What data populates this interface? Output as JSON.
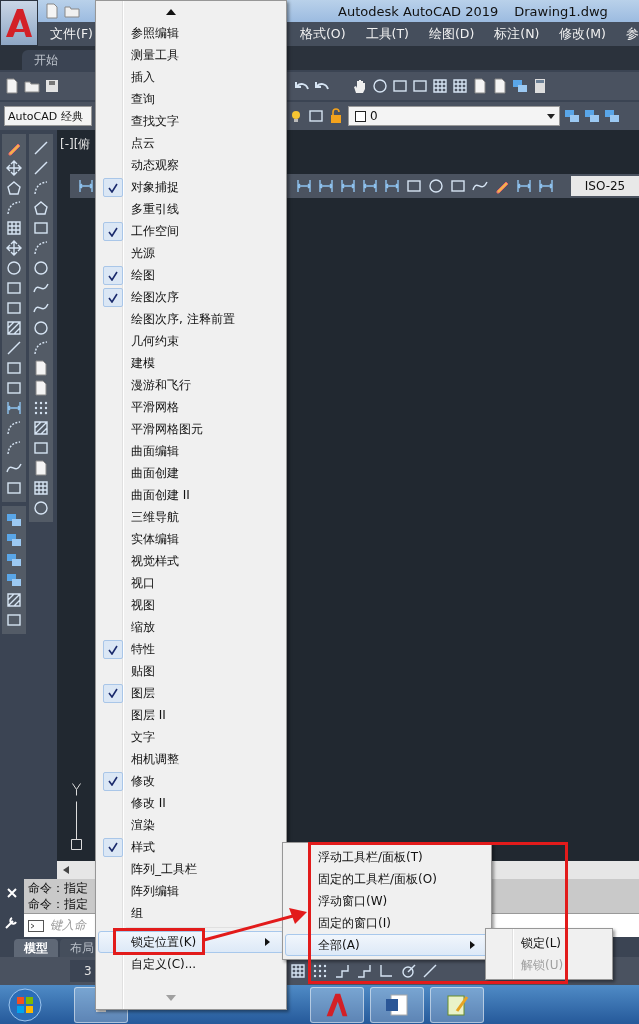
{
  "title_bar": {
    "title": "Autodesk AutoCAD 2019",
    "document": "Drawing1.dwg"
  },
  "menu_bar": {
    "first": "文件(F)",
    "rest": [
      "格式(O)",
      "工具(T)",
      "绘图(D)",
      "标注(N)",
      "修改(M)",
      "参"
    ]
  },
  "start_tab": "开始",
  "workspace": "AutoCAD 经典",
  "layer": "0",
  "viewport_label": "[-][俯",
  "dim_style": "ISO-25",
  "command_history": [
    "命令：指定",
    "命令：指定"
  ],
  "command_placeholder": "键入命",
  "layout_tabs": [
    {
      "label": "模型",
      "selected": true
    },
    {
      "label": "布局",
      "selected": false
    }
  ],
  "status_bar": {
    "scale": "3"
  },
  "toolbar_menu": {
    "items": [
      {
        "label": "参照编辑",
        "checked": false
      },
      {
        "label": "测量工具",
        "checked": false
      },
      {
        "label": "插入",
        "checked": false
      },
      {
        "label": "查询",
        "checked": false
      },
      {
        "label": "查找文字",
        "checked": false
      },
      {
        "label": "点云",
        "checked": false
      },
      {
        "label": "动态观察",
        "checked": false
      },
      {
        "label": "对象捕捉",
        "checked": true
      },
      {
        "label": "多重引线",
        "checked": false
      },
      {
        "label": "工作空间",
        "checked": true
      },
      {
        "label": "光源",
        "checked": false
      },
      {
        "label": "绘图",
        "checked": true
      },
      {
        "label": "绘图次序",
        "checked": true
      },
      {
        "label": "绘图次序, 注释前置",
        "checked": false
      },
      {
        "label": "几何约束",
        "checked": false
      },
      {
        "label": "建模",
        "checked": false
      },
      {
        "label": "漫游和飞行",
        "checked": false
      },
      {
        "label": "平滑网格",
        "checked": false
      },
      {
        "label": "平滑网格图元",
        "checked": false
      },
      {
        "label": "曲面编辑",
        "checked": false
      },
      {
        "label": "曲面创建",
        "checked": false
      },
      {
        "label": "曲面创建 II",
        "checked": false
      },
      {
        "label": "三维导航",
        "checked": false
      },
      {
        "label": "实体编辑",
        "checked": false
      },
      {
        "label": "视觉样式",
        "checked": false
      },
      {
        "label": "视口",
        "checked": false
      },
      {
        "label": "视图",
        "checked": false
      },
      {
        "label": "缩放",
        "checked": false
      },
      {
        "label": "特性",
        "checked": true
      },
      {
        "label": "贴图",
        "checked": false
      },
      {
        "label": "图层",
        "checked": true
      },
      {
        "label": "图层 II",
        "checked": false
      },
      {
        "label": "文字",
        "checked": false
      },
      {
        "label": "相机调整",
        "checked": false
      },
      {
        "label": "修改",
        "checked": true
      },
      {
        "label": "修改 II",
        "checked": false
      },
      {
        "label": "渲染",
        "checked": false
      },
      {
        "label": "样式",
        "checked": true
      },
      {
        "label": "阵列_工具栏",
        "checked": false
      },
      {
        "label": "阵列编辑",
        "checked": false
      },
      {
        "label": "组",
        "checked": false
      }
    ],
    "lock_item": {
      "label": "锁定位置(K)",
      "selected": true
    },
    "customize": "自定义(C)..."
  },
  "lock_submenu": [
    {
      "label": "浮动工具栏/面板(T)",
      "selected": false,
      "kind": "command"
    },
    {
      "label": "固定的工具栏/面板(O)",
      "selected": false,
      "kind": "command"
    },
    {
      "label": "浮动窗口(W)",
      "selected": false,
      "kind": "command"
    },
    {
      "label": "固定的窗口(I)",
      "selected": false,
      "kind": "command"
    },
    {
      "label": "全部(A)",
      "selected": true,
      "kind": "submenu"
    }
  ],
  "all_submenu": [
    {
      "label": "锁定(L)",
      "disabled": false
    },
    {
      "label": "解锁(U)",
      "disabled": true
    }
  ]
}
